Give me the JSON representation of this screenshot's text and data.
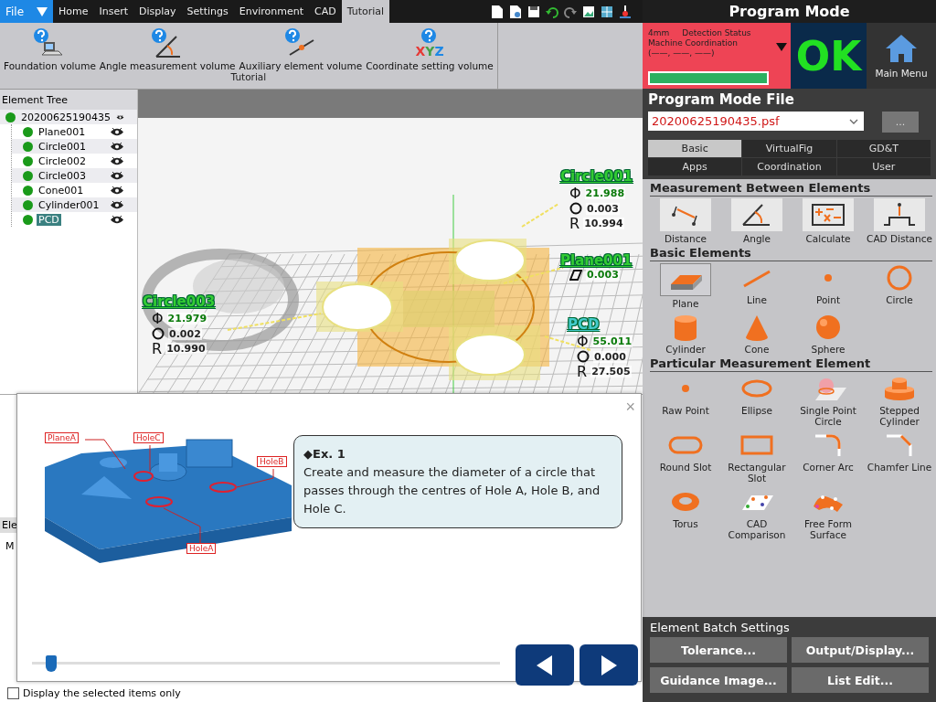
{
  "menu_bar": {
    "file": "File",
    "tabs": [
      {
        "label": "Home",
        "selected": false
      },
      {
        "label": "Insert",
        "selected": false
      },
      {
        "label": "Display",
        "selected": false
      },
      {
        "label": "Settings",
        "selected": false
      },
      {
        "label": "Environment",
        "selected": false
      },
      {
        "label": "CAD",
        "selected": false
      },
      {
        "label": "Tutorial",
        "selected": true
      }
    ]
  },
  "ribbon": {
    "buttons": [
      {
        "label": "Foundation volume",
        "kind": "probe"
      },
      {
        "label": "Angle measurement volume",
        "kind": "angle"
      },
      {
        "label": "Auxiliary element volume",
        "kind": "auxiliary"
      },
      {
        "label": "Coordinate setting volume",
        "kind": "coordinate",
        "letters": "XYZ"
      }
    ],
    "group_label": "Tutorial"
  },
  "element_tree": {
    "title": "Element Tree",
    "root": {
      "label": "20200625190435",
      "children": [
        {
          "label": "Plane001",
          "selected": false
        },
        {
          "label": "Circle001",
          "selected": false
        },
        {
          "label": "Circle002",
          "selected": false
        },
        {
          "label": "Circle003",
          "selected": false
        },
        {
          "label": "Cone001",
          "selected": false
        },
        {
          "label": "Cylinder001",
          "selected": false
        },
        {
          "label": "PCD",
          "selected": true
        }
      ]
    }
  },
  "viewport": {
    "annotations": [
      {
        "title": "Circle001",
        "color": "#33cc33",
        "rows": [
          {
            "kind": "text",
            "symbol": "Φ",
            "value": "21.988",
            "highlighted": true
          },
          {
            "kind": "roundness",
            "value": "0.003",
            "highlighted": false
          },
          {
            "kind": "text",
            "symbol": "R",
            "value": "10.994",
            "highlighted": false
          }
        ]
      },
      {
        "title": "Plane001",
        "color": "#33cc33",
        "rows": [
          {
            "kind": "flatness",
            "value": "0.003",
            "highlighted": true
          }
        ]
      },
      {
        "title": "Circle003",
        "color": "#33cc33",
        "rows": [
          {
            "kind": "text",
            "symbol": "Φ",
            "value": "21.979",
            "highlighted": true
          },
          {
            "kind": "roundness",
            "value": "0.002",
            "highlighted": false
          },
          {
            "kind": "text",
            "symbol": "R",
            "value": "10.990",
            "highlighted": false
          }
        ]
      },
      {
        "title": "PCD",
        "color": "#44cccc",
        "rows": [
          {
            "kind": "text",
            "symbol": "Φ",
            "value": "55.011",
            "highlighted": true
          },
          {
            "kind": "roundness",
            "value": "0.000",
            "highlighted": false
          },
          {
            "kind": "text",
            "symbol": "R",
            "value": "27.505",
            "highlighted": false
          }
        ]
      }
    ]
  },
  "lower_panel": {
    "tab": "Ele",
    "column": "M",
    "checkbox": {
      "label": "Display the selected items only",
      "checked": false
    }
  },
  "tutorial_dialog": {
    "close": "×",
    "callouts": [
      "PlaneA",
      "HoleC",
      "HoleB",
      "HoleA"
    ],
    "heading": "◆Ex. 1",
    "text": "Create and measure the diameter of a circle that passes through the centres of Hole A, Hole B, and Hole C.",
    "slider": {
      "level": 0.03
    }
  },
  "right_panel": {
    "title": "Program Mode",
    "status": {
      "probe": "4mm",
      "detection": "Detection Status",
      "coordinate_label": "Machine Coordination",
      "coordinate_value": "(——, ——, ——)",
      "result": "OK"
    },
    "main_menu": "Main Menu",
    "file_section": {
      "title": "Program Mode File",
      "file": "20200625190435.psf",
      "browse": "..."
    },
    "tabs": [
      {
        "label": "Basic",
        "selected": true
      },
      {
        "label": "VirtualFig",
        "selected": false
      },
      {
        "label": "GD&T",
        "selected": false
      },
      {
        "label": "Apps",
        "selected": false
      },
      {
        "label": "Coordination",
        "selected": false
      },
      {
        "label": "User",
        "selected": false
      }
    ],
    "sections": [
      {
        "title": "Measurement Between Elements",
        "kind": "tools",
        "items": [
          {
            "label": "Distance",
            "kind": "distance",
            "selected": false
          },
          {
            "label": "Angle",
            "kind": "angle",
            "selected": false
          },
          {
            "label": "Calculate",
            "kind": "calculate",
            "selected": false
          },
          {
            "label": "CAD Distance",
            "kind": "cad-distance",
            "selected": false
          }
        ]
      },
      {
        "title": "Basic Elements",
        "kind": "elements",
        "items": [
          {
            "label": "Plane",
            "kind": "plane",
            "selected": true
          },
          {
            "label": "Line",
            "kind": "line",
            "selected": false
          },
          {
            "label": "Point",
            "kind": "point",
            "selected": false
          },
          {
            "label": "Circle",
            "kind": "circle",
            "selected": false
          },
          {
            "label": "Cylinder",
            "kind": "cylinder",
            "selected": false
          },
          {
            "label": "Cone",
            "kind": "cone",
            "selected": false
          },
          {
            "label": "Sphere",
            "kind": "sphere",
            "selected": false
          }
        ]
      },
      {
        "title": "Particular Measurement Element",
        "kind": "elements",
        "items": [
          {
            "label": "Raw Point",
            "kind": "point",
            "selected": false
          },
          {
            "label": "Ellipse",
            "kind": "ellipse",
            "selected": false
          },
          {
            "label": "Single Point Circle",
            "kind": "single-point-circle",
            "selected": false
          },
          {
            "label": "Stepped Cylinder",
            "kind": "stepped-cylinder",
            "selected": false
          },
          {
            "label": "Round Slot",
            "kind": "round-slot",
            "selected": false
          },
          {
            "label": "Rectangular Slot",
            "kind": "rectangular-slot",
            "selected": false
          },
          {
            "label": "Corner Arc",
            "kind": "corner-arc",
            "selected": false
          },
          {
            "label": "Chamfer Line",
            "kind": "chamfer-line",
            "selected": false
          },
          {
            "label": "Torus",
            "kind": "torus",
            "selected": false
          },
          {
            "label": "CAD Comparison",
            "kind": "cad-comparison",
            "selected": false
          },
          {
            "label": "Free Form Surface",
            "kind": "free-form-surface",
            "selected": false
          }
        ]
      }
    ],
    "batch": {
      "title": "Element Batch Settings",
      "buttons": [
        "Tolerance...",
        "Output/Display...",
        "Guidance Image...",
        "List Edit..."
      ]
    }
  }
}
